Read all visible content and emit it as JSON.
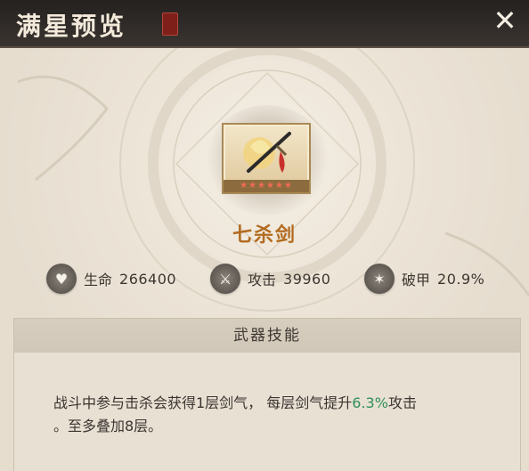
{
  "header": {
    "title": "满星预览",
    "close_icon": "close-icon"
  },
  "item": {
    "name": "七杀剑",
    "stars_text": "★★★★★★",
    "star_count": 6
  },
  "stats": [
    {
      "icon": "heart-icon",
      "icon_glyph": "♥",
      "label": "生命",
      "value": "266400"
    },
    {
      "icon": "sword-icon",
      "icon_glyph": "⚔",
      "label": "攻击",
      "value": "39960"
    },
    {
      "icon": "armor-break-icon",
      "icon_glyph": "✶",
      "label": "破甲",
      "value": "20.9%"
    }
  ],
  "skill": {
    "title": "武器技能",
    "text_part1": "战斗中参与击杀会获得1层剑气， 每层剑气提升",
    "highlight": "6.3%",
    "text_part2": "攻击",
    "text_line2": "。至多叠加8层。"
  },
  "colors": {
    "highlight": "#2f8f5a",
    "item_name": "#b26b20",
    "header_bg": "#2a2623"
  }
}
